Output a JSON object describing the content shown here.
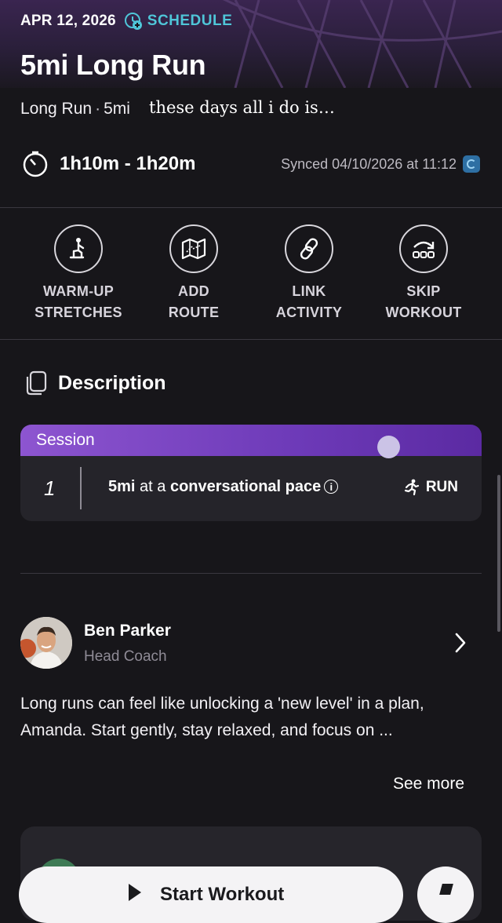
{
  "header": {
    "date": "APR 12, 2026",
    "schedule_label": "SCHEDULE",
    "title": "5mi Long Run",
    "workout_type": "Long Run",
    "separator": "·",
    "distance": "5mi",
    "caption": "these days all i do is…"
  },
  "duration": {
    "range": "1h10m - 1h20m",
    "synced_text": "Synced 04/10/2026 at 11:12"
  },
  "actions": [
    {
      "line1": "WARM-UP",
      "line2": "STRETCHES",
      "icon": "stretch-icon"
    },
    {
      "line1": "ADD",
      "line2": "ROUTE",
      "icon": "map-icon"
    },
    {
      "line1": "LINK",
      "line2": "ACTIVITY",
      "icon": "link-icon"
    },
    {
      "line1": "SKIP",
      "line2": "WORKOUT",
      "icon": "skip-icon"
    }
  ],
  "description": {
    "title": "Description"
  },
  "session": {
    "label": "Session",
    "step_number": "1",
    "step_bold1": "5mi",
    "step_mid": " at a ",
    "step_bold2": "conversational pace",
    "info_symbol": "i",
    "activity_tag": "RUN"
  },
  "coach": {
    "name": "Ben Parker",
    "role": "Head Coach",
    "message": "Long runs can feel like unlocking a 'new level' in a plan, Amanda. Start gently, stay relaxed, and focus on ...",
    "see_more": "See more"
  },
  "footer": {
    "start_label": "Start Workout"
  },
  "colors": {
    "background": "#17161a",
    "accent_teal": "#4fc6d8",
    "session_purple": "#8d55d0",
    "muted_text": "#8f8b96"
  }
}
